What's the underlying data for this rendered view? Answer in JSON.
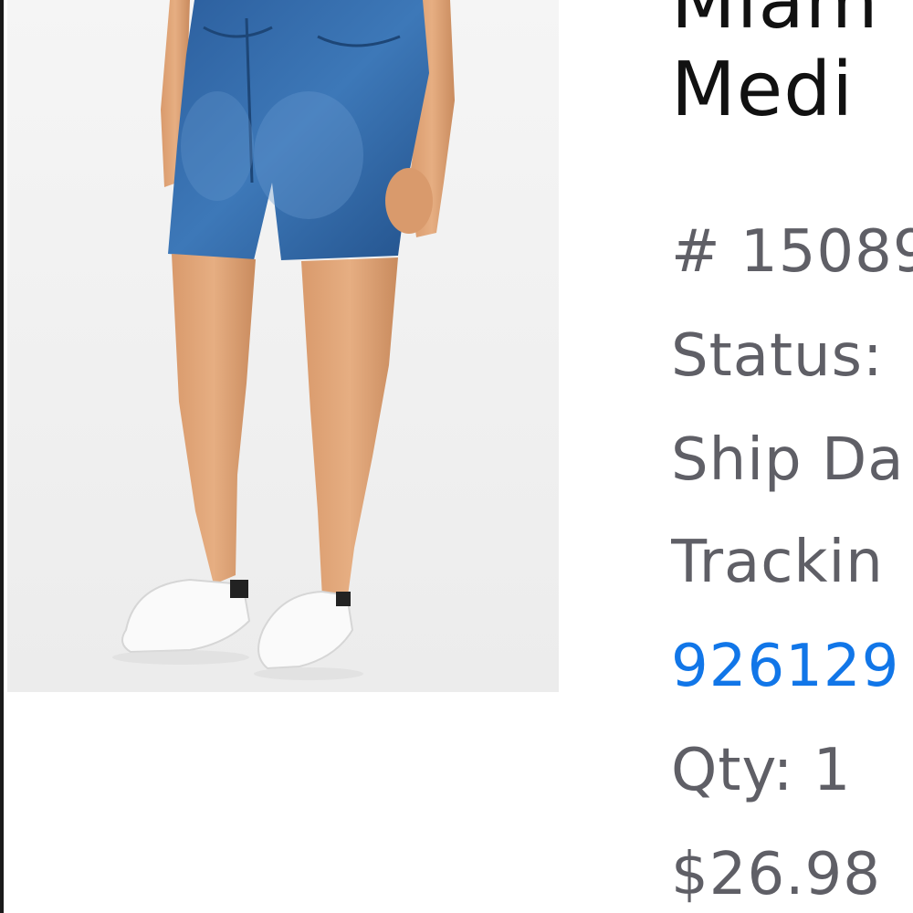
{
  "product": {
    "image_alt": "Denim shorts product photo",
    "title_line_1": "Miam",
    "title_line_2": "Medi"
  },
  "order": {
    "number": "# 15089",
    "status_label": "Status:",
    "ship_date_label": "Ship Da",
    "tracking_label": "Trackin",
    "tracking_number": "926129",
    "qty": "Qty: 1",
    "price": "$26.98"
  },
  "colors": {
    "link": "#1176e8",
    "label": "#5f5f66",
    "title": "#111111"
  }
}
